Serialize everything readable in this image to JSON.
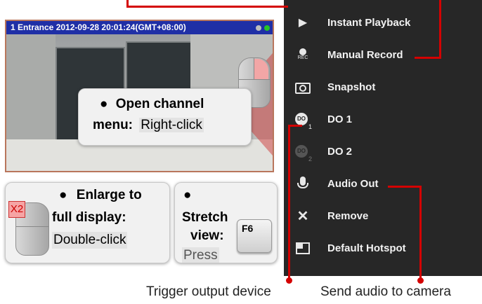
{
  "camera": {
    "title": "1 Entrance  2012-09-28 20:01:24(GMT+08:00)",
    "led_colors": [
      "#bdbdbd",
      "#27c427"
    ]
  },
  "callouts": {
    "open_menu": {
      "bullet": "●",
      "label_line1": "Open channel",
      "label_line2": "menu:",
      "action": "Right-click"
    },
    "enlarge": {
      "bullet": "●",
      "label_line1": "Enlarge to",
      "label_line2": "full display:",
      "action": "Double-click",
      "badge": "X2"
    },
    "stretch": {
      "bullet": "●",
      "label_line1": "Stretch",
      "label_line2": "view:",
      "key": "F6",
      "action_partial": "Press"
    }
  },
  "menu": {
    "items": [
      {
        "label": "Instant Playback",
        "icon": "play-icon"
      },
      {
        "label": "Manual Record",
        "icon": "rec-icon",
        "icon_text": "REC"
      },
      {
        "label": "Snapshot",
        "icon": "camera-icon"
      },
      {
        "label": "DO 1",
        "icon": "do1-icon",
        "icon_text": "DO",
        "subscript": "1"
      },
      {
        "label": "DO 2",
        "icon": "do2-icon",
        "icon_text": "DO",
        "subscript": "2"
      },
      {
        "label": "Audio Out",
        "icon": "microphone-icon"
      },
      {
        "label": "Remove",
        "icon": "close-icon"
      },
      {
        "label": "Default Hotspot",
        "icon": "hotspot-icon"
      }
    ]
  },
  "captions": {
    "trigger": "Trigger output device",
    "audio": "Send audio to camera"
  },
  "colors": {
    "accent_red": "#d40000",
    "menu_bg": "#272727",
    "title_bar": "#1f2fa6"
  }
}
